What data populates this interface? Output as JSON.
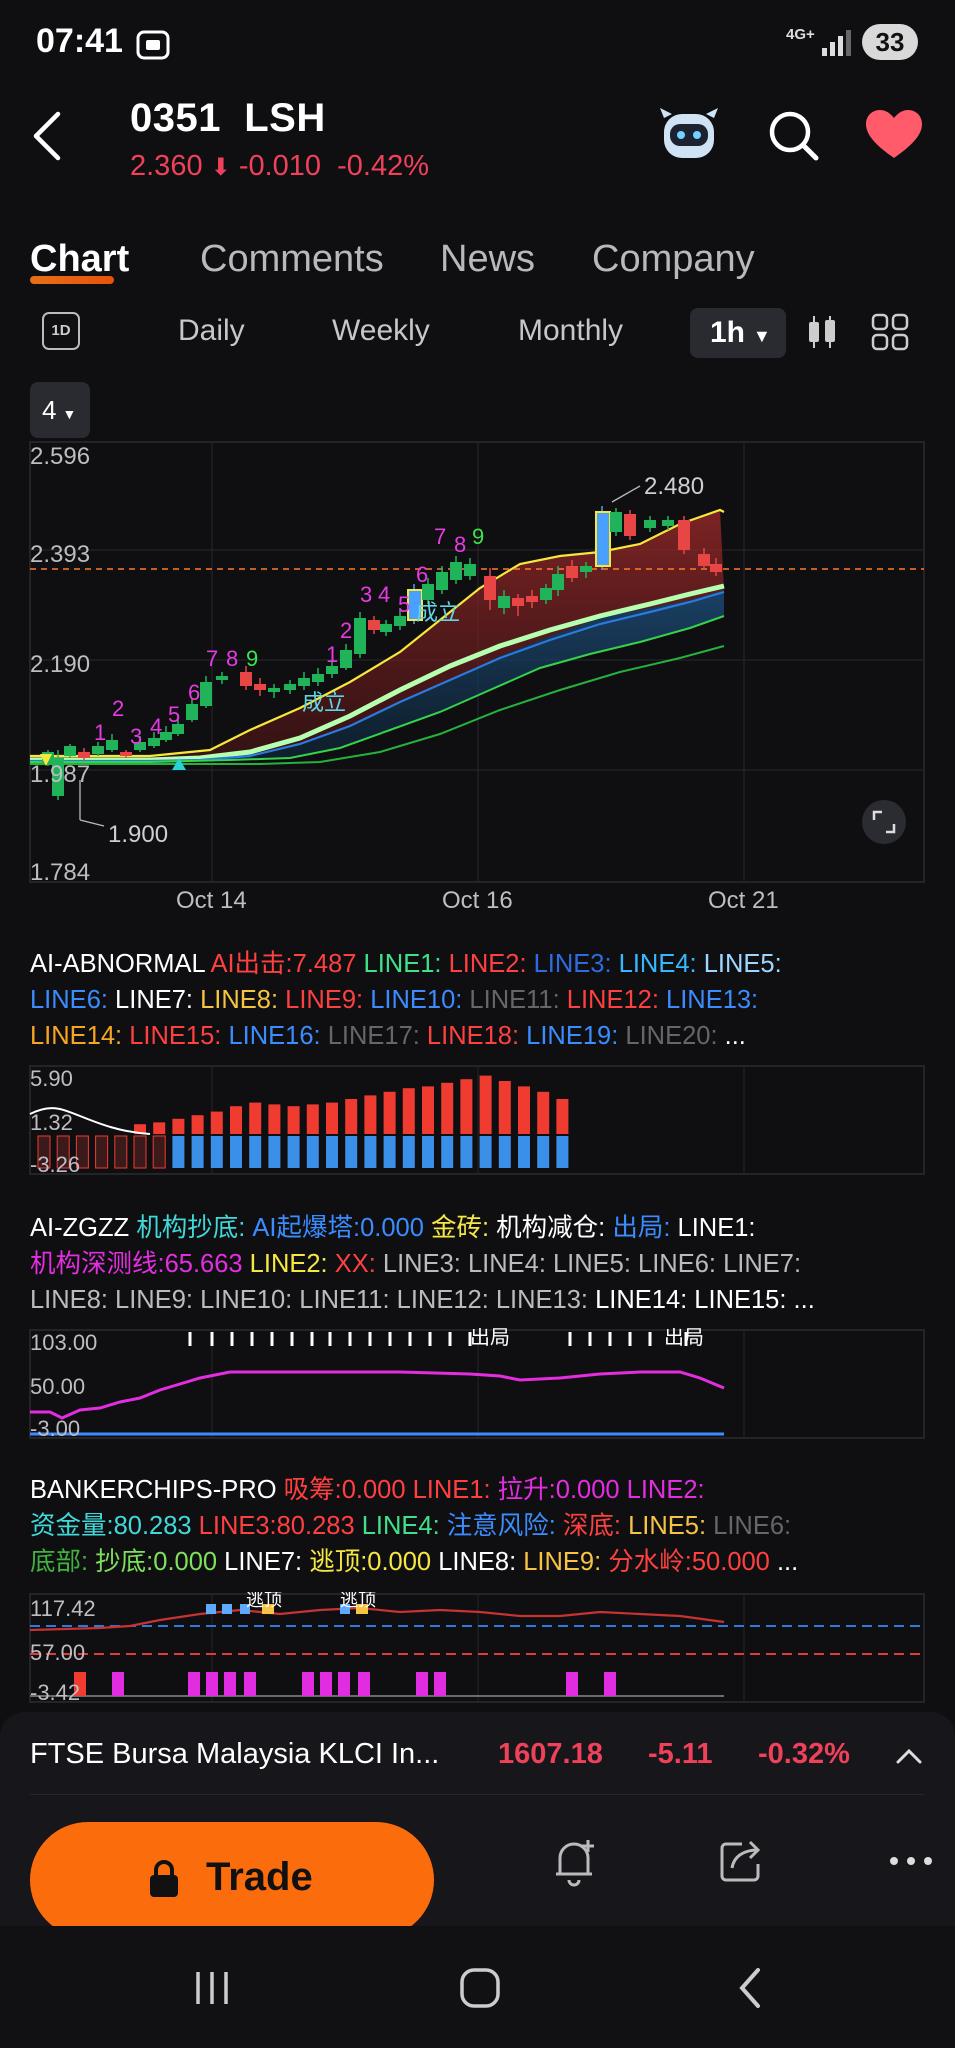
{
  "status": {
    "time": "07:41",
    "network": "4G+",
    "battery": "33"
  },
  "header": {
    "symbol": "0351",
    "name": "LSH",
    "price": "2.360",
    "change": "-0.010",
    "change_pct": "-0.42%",
    "colors": {
      "down": "#f0415a",
      "heart": "#ff5b6b"
    }
  },
  "tabs": [
    {
      "label": "Chart"
    },
    {
      "label": "Comments"
    },
    {
      "label": "News"
    },
    {
      "label": "Company"
    }
  ],
  "periods": {
    "icon_label": "1D",
    "daily": "Daily",
    "weekly": "Weekly",
    "monthly": "Monthly",
    "selected": "1h"
  },
  "chart": {
    "selector": "4",
    "y_ticks": [
      "2.596",
      "2.393",
      "2.190",
      "1.987",
      "1.784"
    ],
    "x_ticks": [
      "Oct 14",
      "Oct 16",
      "Oct 21"
    ],
    "max_label": "2.480",
    "min_label": "1.900",
    "signal_label": "成立",
    "countdown_labels": [
      "1",
      "2",
      "3",
      "4",
      "5",
      "6",
      "7",
      "8",
      "9"
    ]
  },
  "ind1": {
    "title": "AI-ABNORMAL",
    "line1": [
      {
        "t": "AI-ABNORMAL ",
        "c": "#ffffff"
      },
      {
        "t": "AI出击:7.487",
        "c": "#ff4040"
      },
      {
        "t": "  LINE1:",
        "c": "#3fe28a"
      },
      {
        "t": "  LINE2:",
        "c": "#ff4040"
      },
      {
        "t": "  LINE3:",
        "c": "#2f6be0"
      },
      {
        "t": "  LINE4:",
        "c": "#35b8ff"
      },
      {
        "t": "  LINE5:",
        "c": "#9fd6ff"
      }
    ],
    "line2": [
      {
        "t": "LINE6:",
        "c": "#3a8cff"
      },
      {
        "t": " LINE7:",
        "c": "#ffffff"
      },
      {
        "t": "  LINE8:",
        "c": "#f6c343"
      },
      {
        "t": " LINE9:",
        "c": "#ff4040"
      },
      {
        "t": " LINE10:",
        "c": "#3a8cff"
      },
      {
        "t": "  LINE11:",
        "c": "#666666"
      },
      {
        "t": "   LINE12:",
        "c": "#ff4040"
      },
      {
        "t": "  LINE13:",
        "c": "#3a8cff"
      }
    ],
    "line3": [
      {
        "t": "LINE14:",
        "c": "#f6a623"
      },
      {
        "t": "  LINE15:",
        "c": "#ff4040"
      },
      {
        "t": "  LINE16:",
        "c": "#3a8cff"
      },
      {
        "t": "  LINE17:",
        "c": "#666666"
      },
      {
        "t": "  LINE18:",
        "c": "#ff4040"
      },
      {
        "t": "  LINE19:",
        "c": "#3a8cff"
      },
      {
        "t": "  LINE20:",
        "c": "#666666"
      },
      {
        "t": "  ...",
        "c": "#ffffff"
      }
    ],
    "ticks": [
      "5.90",
      "1.32",
      "-3.26"
    ]
  },
  "ind2": {
    "line1": [
      {
        "t": "AI-ZGZZ ",
        "c": "#ffffff"
      },
      {
        "t": "机构抄底:",
        "c": "#3fd9d9"
      },
      {
        "t": " AI起爆塔:0.000 ",
        "c": "#3a8cff"
      },
      {
        "t": "金砖:",
        "c": "#f6e843"
      },
      {
        "t": " 机构减仓:",
        "c": "#ffffff"
      },
      {
        "t": " 出局:",
        "c": "#3a8cff"
      },
      {
        "t": " LINE1:",
        "c": "#ffffff"
      }
    ],
    "line2": [
      {
        "t": "机构深测线:65.663 ",
        "c": "#e32ee0"
      },
      {
        "t": "LINE2:",
        "c": "#f6e843"
      },
      {
        "t": " XX:",
        "c": "#ff4040"
      },
      {
        "t": " LINE3: LINE4: LINE5: LINE6: LINE7:",
        "c": "#bbbbbb"
      }
    ],
    "line3": [
      {
        "t": "LINE8: LINE9: LINE10:  LINE11:   LINE12:  LINE13:",
        "c": "#bbbbbb"
      },
      {
        "t": "  LINE14:  LINE15:  ...",
        "c": "#ffffff"
      }
    ],
    "ticks": [
      "103.00",
      "50.00",
      "-3.00"
    ],
    "exit_label": "出局"
  },
  "ind3": {
    "line1": [
      {
        "t": "BANKERCHIPS-PRO ",
        "c": "#ffffff"
      },
      {
        "t": "吸筹:0.000 LINE1:",
        "c": "#ff4040"
      },
      {
        "t": "  拉升:0.000 LINE2:",
        "c": "#e32ee0"
      }
    ],
    "line2": [
      {
        "t": "资金量:80.283 ",
        "c": "#3fd9d9"
      },
      {
        "t": "LINE3:80.283",
        "c": "#ff4040"
      },
      {
        "t": "  LINE4:",
        "c": "#3fe28a"
      },
      {
        "t": " 注意风险:",
        "c": "#3a8cff"
      },
      {
        "t": " 深底:",
        "c": "#ff4040"
      },
      {
        "t": " LINE5:",
        "c": "#f6c343"
      },
      {
        "t": " LINE6:",
        "c": "#666666"
      }
    ],
    "line3": [
      {
        "t": "底部:",
        "c": "#3fb23f"
      },
      {
        "t": " 抄底:0.000",
        "c": "#7fe05a"
      },
      {
        "t": " LINE7:",
        "c": "#ffffff"
      },
      {
        "t": "  逃顶:0.000",
        "c": "#f6e843"
      },
      {
        "t": " LINE8:",
        "c": "#ffffff"
      },
      {
        "t": " LINE9:",
        "c": "#f6c343"
      },
      {
        "t": " 分水岭:50.000",
        "c": "#ff4040"
      },
      {
        "t": " ...",
        "c": "#ffffff"
      }
    ],
    "ticks": [
      "117.42",
      "57.00",
      "-3.42"
    ],
    "escape_label": "逃顶"
  },
  "ticker": {
    "name": "FTSE Bursa Malaysia KLCI In...",
    "price": "1607.18",
    "change": "-5.11",
    "pct": "-0.32%"
  },
  "actions": {
    "trade": "Trade"
  }
}
